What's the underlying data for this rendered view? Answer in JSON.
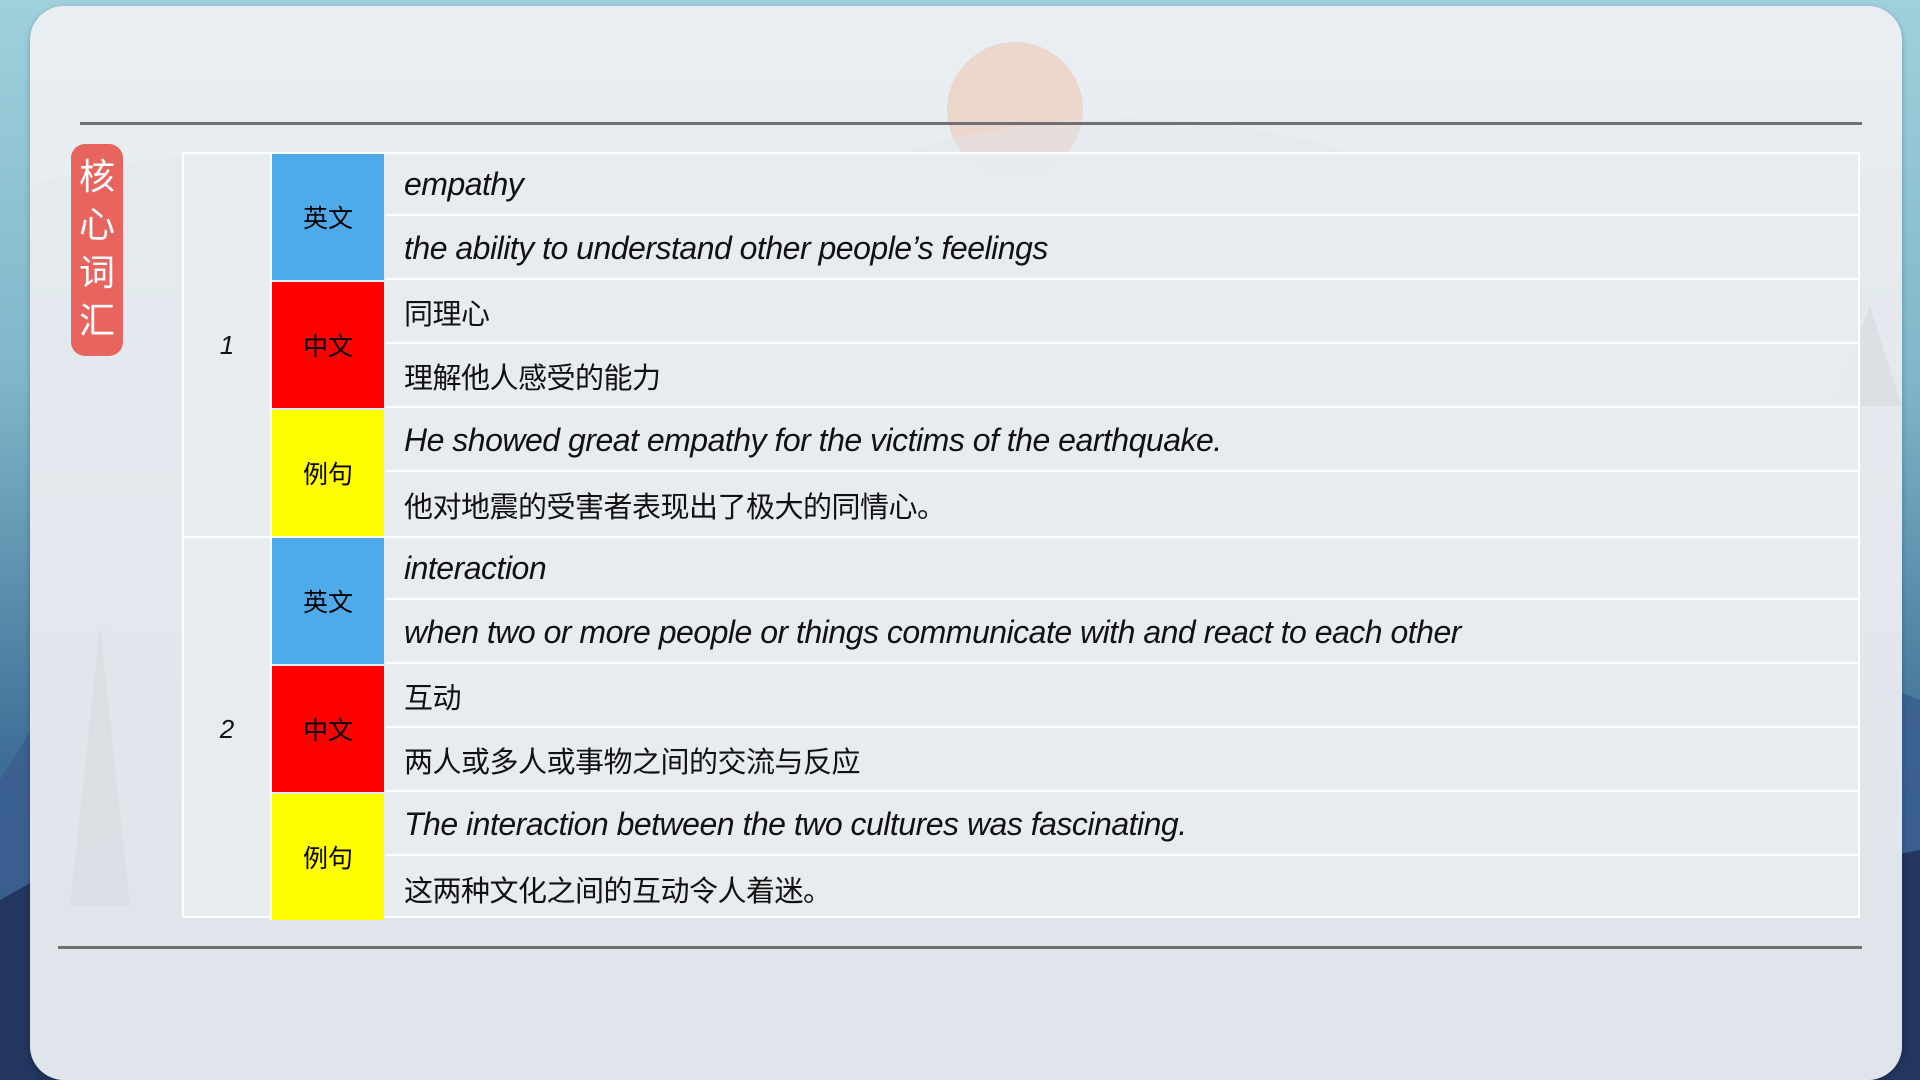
{
  "badge": {
    "chars": [
      "核",
      "心",
      "词",
      "汇"
    ]
  },
  "tags": {
    "english": "英文",
    "chinese": "中文",
    "example": "例句"
  },
  "entries": [
    {
      "number": "1",
      "english_word": "empathy",
      "english_definition": "the ability to understand other people’s feelings",
      "chinese_word": "同理心",
      "chinese_definition": "理解他人感受的能力",
      "example_en": "He showed great empathy for the victims of the earthquake.",
      "example_cn": "他对地震的受害者表现出了极大的同情心。"
    },
    {
      "number": "2",
      "english_word": "interaction",
      "english_definition": "when two or more people or things communicate with and react to each other",
      "chinese_word": "互动",
      "chinese_definition": "两人或多人或事物之间的交流与反应",
      "example_en": "The interaction between the two cultures was fascinating.",
      "example_cn": "这两种文化之间的互动令人着迷。"
    }
  ],
  "colors": {
    "badge": "#e8645f",
    "tag_english": "#4faaea",
    "tag_chinese": "#fe0000",
    "tag_example": "#fefe00"
  }
}
